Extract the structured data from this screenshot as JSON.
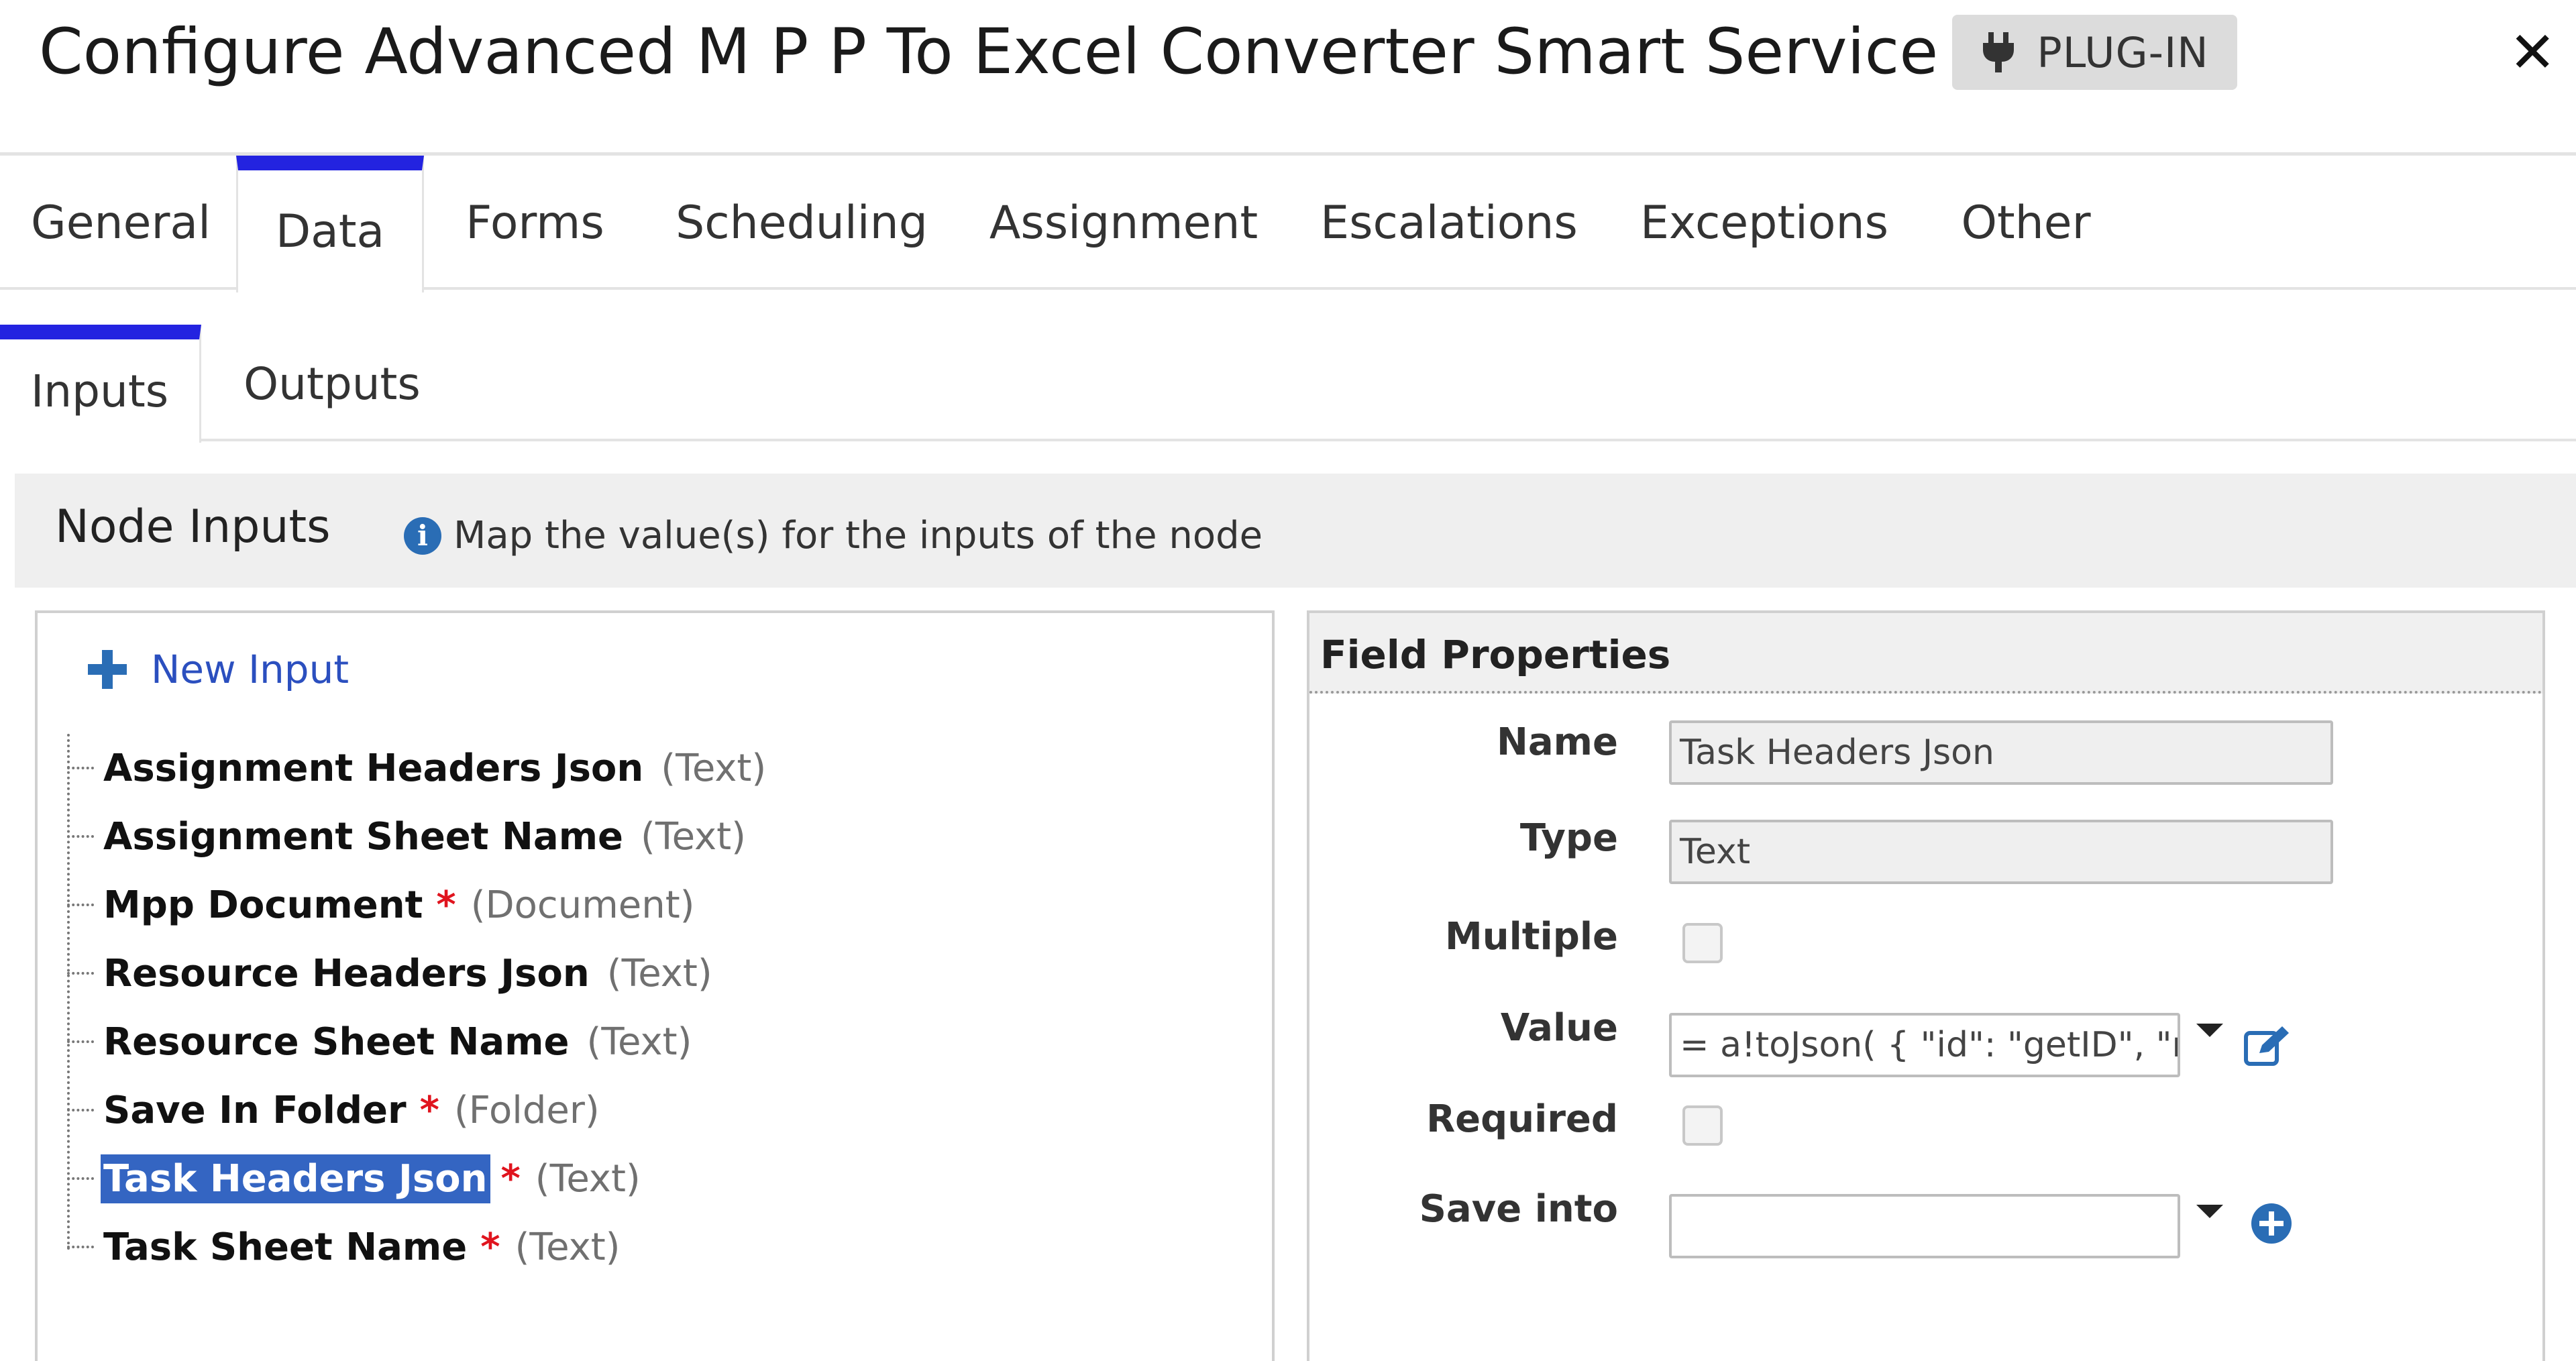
{
  "dialog": {
    "title": "Configure Advanced M P P To Excel Converter Smart Service",
    "badge_label": "PLUG-IN",
    "close_icon": "close-icon"
  },
  "tabs": [
    {
      "label": "General"
    },
    {
      "label": "Data",
      "active": true
    },
    {
      "label": "Forms"
    },
    {
      "label": "Scheduling"
    },
    {
      "label": "Assignment"
    },
    {
      "label": "Escalations"
    },
    {
      "label": "Exceptions"
    },
    {
      "label": "Other"
    }
  ],
  "subtabs": [
    {
      "label": "Inputs",
      "active": true
    },
    {
      "label": "Outputs"
    }
  ],
  "node_inputs": {
    "title": "Node Inputs",
    "info_text": "Map the value(s) for the inputs of the node",
    "new_input_label": "New Input",
    "items": [
      {
        "name": "Assignment Headers Json",
        "required": false,
        "type": "(Text)"
      },
      {
        "name": "Assignment Sheet Name",
        "required": false,
        "type": "(Text)"
      },
      {
        "name": "Mpp Document",
        "required": true,
        "type": "(Document)"
      },
      {
        "name": "Resource Headers Json",
        "required": false,
        "type": "(Text)"
      },
      {
        "name": "Resource Sheet Name",
        "required": false,
        "type": "(Text)"
      },
      {
        "name": "Save In Folder",
        "required": true,
        "type": "(Folder)"
      },
      {
        "name": "Task Headers Json",
        "required": true,
        "type": "(Text)",
        "selected": true
      },
      {
        "name": "Task Sheet Name",
        "required": true,
        "type": "(Text)"
      }
    ],
    "required_marker": "*"
  },
  "field_properties": {
    "title": "Field Properties",
    "name_label": "Name",
    "name_value": "Task Headers Json",
    "type_label": "Type",
    "type_value": "Text",
    "multiple_label": "Multiple",
    "multiple_checked": false,
    "value_label": "Value",
    "value_value": "= a!toJson(  {    \"id\": \"getID\",    \"r",
    "required_label": "Required",
    "required_checked": false,
    "save_into_label": "Save into",
    "save_into_value": ""
  },
  "colors": {
    "accent": "#2323e0",
    "selection": "#3465c2",
    "link": "#2b4fbf",
    "icon_blue": "#2a6db5",
    "required": "#e0141e"
  }
}
